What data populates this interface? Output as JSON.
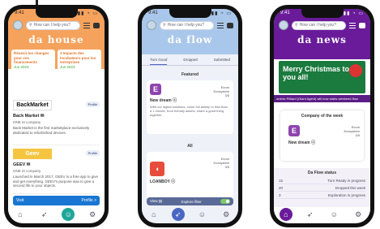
{
  "phones": [
    {
      "id": "dahouse",
      "logo": "da house",
      "search_placeholder": "How can I help you?",
      "news": [
        {
          "title": "Réussir les changes pour vos financements",
          "meta": "Jun 2023"
        },
        {
          "title": "3 Impacts des incubateurs pour les entreprises",
          "meta": "Jun 2023"
        }
      ],
      "companies": [
        {
          "brand": "BackMarket",
          "title": "Back Market ✉",
          "subtitle": "ONE et company",
          "desc": "Back Market is the first marketplace exclusively dedicated to refurbished devices.",
          "pill": "Profile",
          "brand_color": "#ffffff",
          "brand_text": "#111111"
        },
        {
          "brand": "Geev",
          "title": "GEEV ✉",
          "subtitle": "ONE et company",
          "desc": "Launched in March 2017, GEEV is a free app to give and get everything. GEEV's purpose was to give a second life to your objects.",
          "pill": "Profile",
          "brand_color": "#f5c542",
          "brand_text": "#ffffff"
        }
      ],
      "cta_left": "Visit",
      "cta_right": "Profile >",
      "active_color": "#1fa69a"
    },
    {
      "id": "daflow",
      "logo": "da flow",
      "search_placeholder": "How can I help you?",
      "tabs": [
        "Turn Good",
        "Dropped",
        "Submitted"
      ],
      "featured_label": "Featured",
      "all_label": "All",
      "featured": {
        "name": "New dream ⓒ",
        "meta_line1": "Ecom",
        "meta_line2": "Ecosystem",
        "meta_line3": "3/5",
        "desc": "With our digital solutions, come full asleep in less than a 1 minute, from friendly assets, share a good thing together."
      },
      "all_card": {
        "name": "LOANBOY ⓒ",
        "meta_line1": "Ecom",
        "meta_line2": "Ecosystem",
        "meta_line3": "3/5"
      },
      "toggle_left": "View ▤",
      "toggle_right": "Explore filter",
      "active_color": "#4a67c4"
    },
    {
      "id": "danews",
      "logo": "da news",
      "search_placeholder": "How can I help you?",
      "banner_title": "Merry Christmas to you all!",
      "ticker": "ominic Pilliard (Giant Agent) will now starts weekend flow",
      "week_label": "Company of the week",
      "week_company": {
        "name": "New dream ⓒ",
        "meta_line1": "Ecom",
        "meta_line2": "Ecosystem",
        "meta_line3": "3/5"
      },
      "status_label": "Da Flow status",
      "status_rows": [
        {
          "num": "15",
          "text": "Turn Ready in progress"
        },
        {
          "num": "20",
          "text": "Dropped this week"
        },
        {
          "num": "3",
          "text": "Exploration in progress"
        }
      ],
      "active_color": "#6a1b9a"
    }
  ],
  "statusbar": {
    "time": "9:41",
    "icons": "▮▮ ◔ ▭"
  },
  "nav_icons": [
    "home-icon",
    "rocket-icon",
    "people-icon",
    "settings-icon"
  ]
}
